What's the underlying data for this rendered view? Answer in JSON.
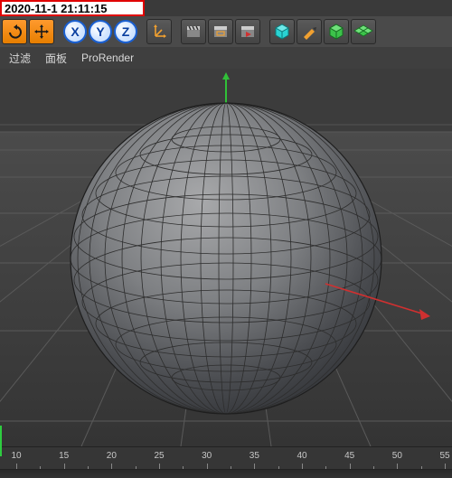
{
  "timestamp": "2020-11-1 21:11:15",
  "axes": {
    "x": "X",
    "y": "Y",
    "z": "Z"
  },
  "menu": {
    "filter": "过滤",
    "panel": "面板",
    "prorender": "ProRender"
  },
  "timeline": {
    "ticks": [
      10,
      15,
      20,
      25,
      30,
      35,
      40,
      45,
      50,
      55
    ]
  },
  "colors": {
    "accent_orange": "#ff8c1a",
    "axis_blue": "#1a5fd0",
    "cube_teal": "#2ad4d4",
    "pen": "#f0a030",
    "cube_green": "#3cc24a",
    "x_axis": "#d03030",
    "y_axis": "#30c038"
  }
}
